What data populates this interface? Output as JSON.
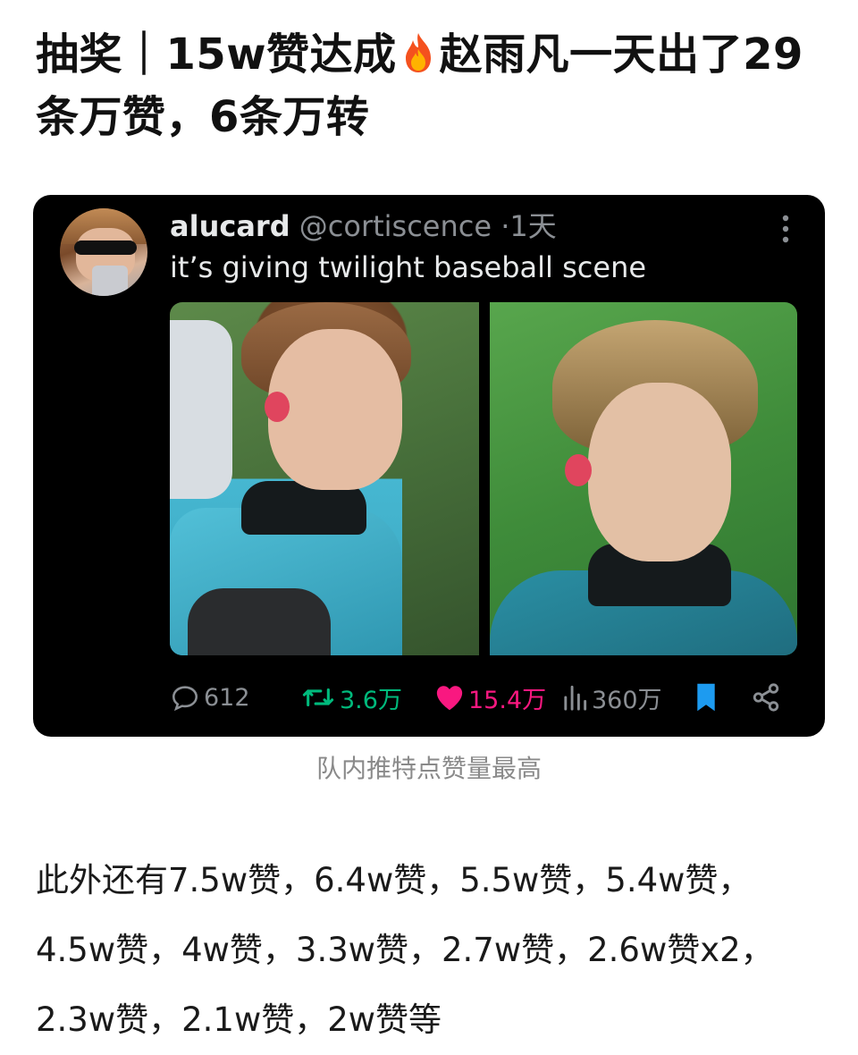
{
  "post": {
    "title_part1": "抽奖｜15w赞达成",
    "title_part2": "赵雨凡一天出了29条万赞，6条万转",
    "fire_icon": "fire-emoji"
  },
  "tweet": {
    "display_name": "alucard",
    "handle": "@cortiscence",
    "separator": "·",
    "time": "1天",
    "text": "it’s giving twilight baseball scene",
    "stats": {
      "replies": "612",
      "retweets": "3.6万",
      "likes": "15.4万",
      "views": "360万"
    },
    "colors": {
      "background": "#000000",
      "retweet": "#00ba7c",
      "like": "#f91880",
      "bookmark": "#1d9bf0",
      "muted": "#8b8f94"
    }
  },
  "caption": "队内推特点赞量最高",
  "body_text": "此外还有7.5w赞，6.4w赞，5.5w赞，5.4w赞，4.5w赞，4w赞，3.3w赞，2.7w赞，2.6w赞x2，2.3w赞，2.1w赞，2w赞等"
}
